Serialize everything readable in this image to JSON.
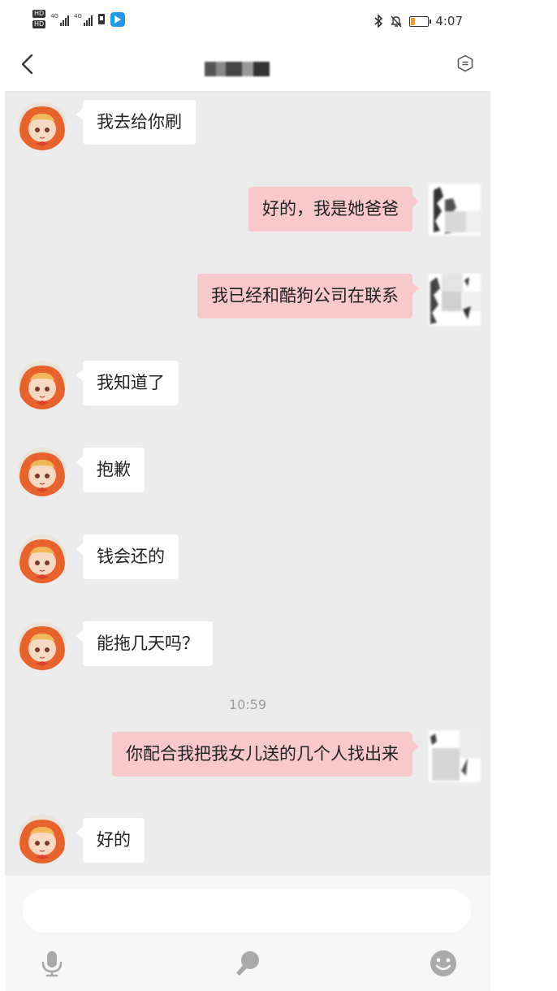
{
  "status_bar": {
    "hd_badges": [
      "HD",
      "HD"
    ],
    "network_labels": [
      "4G",
      "4G"
    ],
    "time": "4:07",
    "battery_percent": 25,
    "icons": [
      "bluetooth-icon",
      "bell-mute-icon",
      "battery-icon",
      "app-notification-icon"
    ]
  },
  "header": {
    "title": "",
    "back_icon": "back-chevron-icon",
    "menu_icon": "chat-menu-icon"
  },
  "messages": [
    {
      "side": "in",
      "text": "我去给你刷"
    },
    {
      "side": "out",
      "text": "好的，我是她爸爸"
    },
    {
      "side": "out",
      "text": "我已经和酷狗公司在联系"
    },
    {
      "side": "in",
      "text": "我知道了"
    },
    {
      "side": "in",
      "text": "抱歉"
    },
    {
      "side": "in",
      "text": "钱会还的"
    },
    {
      "side": "in",
      "text": "能拖几天吗？"
    },
    {
      "side": "time",
      "text": "10:59"
    },
    {
      "side": "out",
      "text": "你配合我把我女儿送的几个人找出来"
    },
    {
      "side": "in",
      "text": "好的"
    }
  ],
  "input": {
    "placeholder": "",
    "icons": [
      "microphone-icon",
      "voice-bubble-icon",
      "emoji-icon"
    ]
  },
  "colors": {
    "chat_background": "#ebebeb",
    "incoming_bubble": "#ffffff",
    "outgoing_bubble": "#f7c9cb",
    "timestamp": "#999999",
    "battery_fill": "#f39c3c"
  }
}
